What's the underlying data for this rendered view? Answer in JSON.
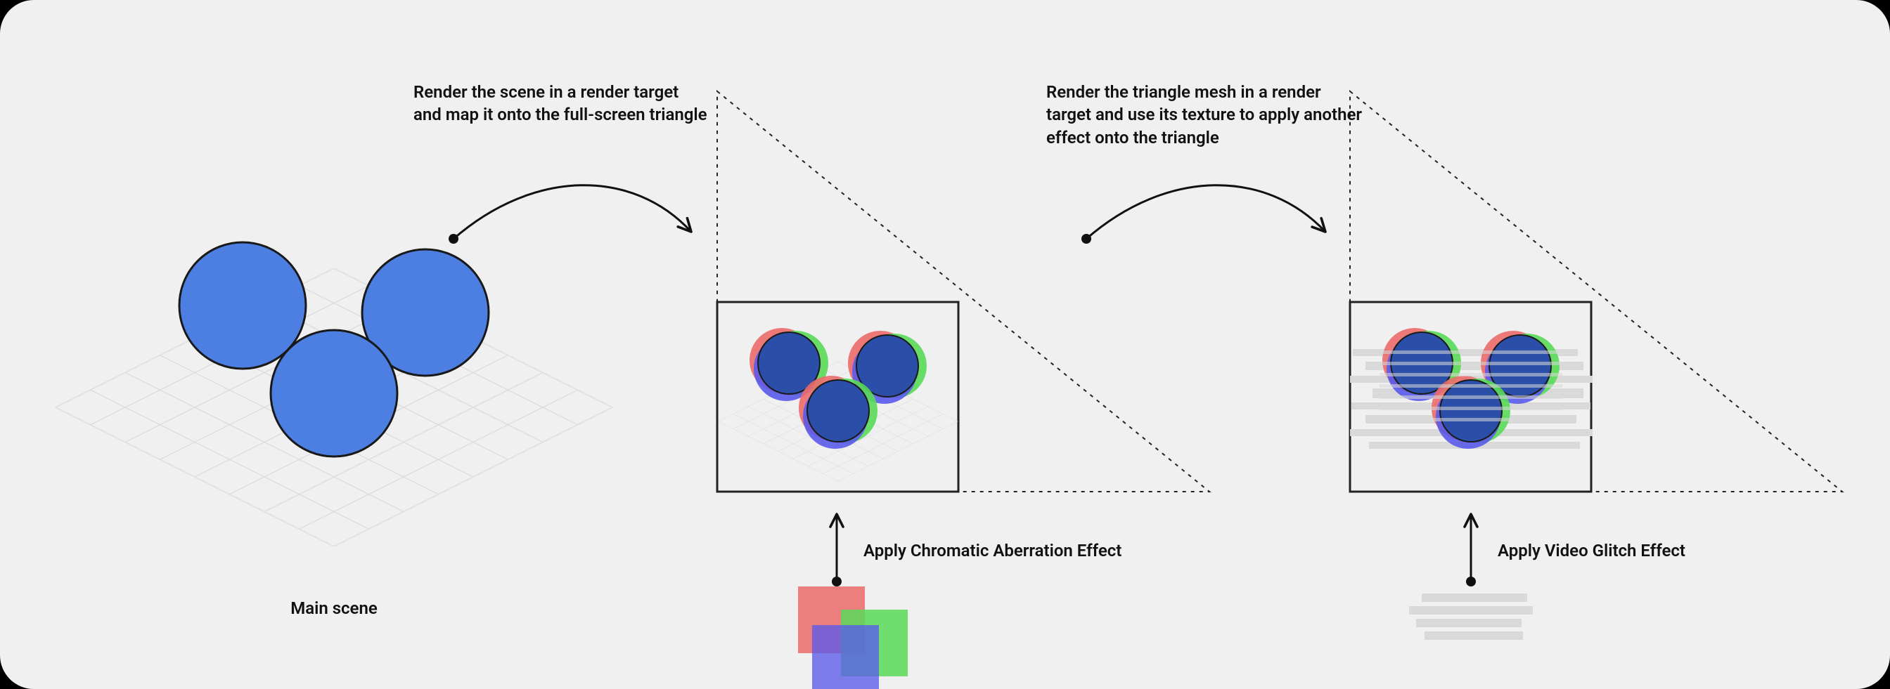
{
  "labels": {
    "main_scene": "Main scene",
    "arrow1": "Render the scene in a render target and map it onto the full-screen triangle",
    "arrow2": "Render the triangle mesh in a render target and use its texture to apply another effect onto the triangle",
    "apply_chromatic": "Apply Chromatic Aberration Effect",
    "apply_glitch": "Apply Video Glitch Effect"
  },
  "colors": {
    "circle": "#4D7FE3",
    "circle_stroke": "#191919",
    "red": "#EB6A6A",
    "green": "#58DA58",
    "blue": "#5A5AEA",
    "glitch_bar": "#D9D9D9",
    "grid": "#d4d4d4",
    "box_bg": "#f0f0f0",
    "box_stroke": "#222"
  }
}
